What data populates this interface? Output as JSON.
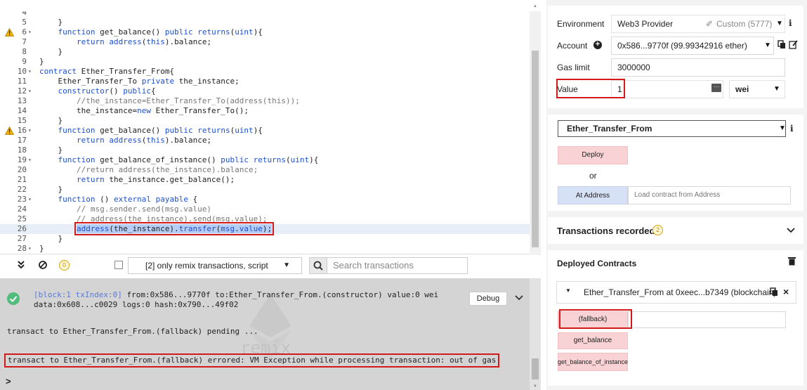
{
  "editor": {
    "lines": [
      {
        "n": "4",
        "fold": false,
        "warn": false,
        "html": "    <span class='kw'></span>"
      },
      {
        "n": "5",
        "fold": false,
        "warn": false,
        "html": "    }"
      },
      {
        "n": "6",
        "fold": true,
        "warn": true,
        "html": "    <span class='kw'>function</span> get_balance() <span class='kw'>public</span> <span class='kw'>returns</span>(<span class='kw'>uint</span>){"
      },
      {
        "n": "7",
        "fold": false,
        "warn": false,
        "html": "        <span class='kw'>return</span> <span class='kw'>address</span>(<span class='kw'>this</span>).balance;"
      },
      {
        "n": "8",
        "fold": false,
        "warn": false,
        "html": "    }"
      },
      {
        "n": "9",
        "fold": false,
        "warn": false,
        "html": "}"
      },
      {
        "n": "10",
        "fold": true,
        "warn": false,
        "html": "<span class='kw'>contract</span> Ether_Transfer_From{"
      },
      {
        "n": "11",
        "fold": false,
        "warn": false,
        "html": "    Ether_Transfer_To <span class='kw'>private</span> the_instance;"
      },
      {
        "n": "12",
        "fold": true,
        "warn": false,
        "html": "    <span class='kw'>constructor</span>() <span class='kw'>public</span>{"
      },
      {
        "n": "13",
        "fold": false,
        "warn": false,
        "html": "        <span class='cm'>//the_instance=Ether_Transfer_To(address(this));</span>"
      },
      {
        "n": "14",
        "fold": false,
        "warn": false,
        "html": "        the_instance=<span class='kw'>new</span> Ether_Transfer_To();"
      },
      {
        "n": "15",
        "fold": false,
        "warn": false,
        "html": "    }"
      },
      {
        "n": "16",
        "fold": true,
        "warn": true,
        "html": "    <span class='kw'>function</span> get_balance() <span class='kw'>public</span> <span class='kw'>returns</span>(<span class='kw'>uint</span>){"
      },
      {
        "n": "17",
        "fold": false,
        "warn": false,
        "html": "        <span class='kw'>return</span> <span class='kw'>address</span>(<span class='kw'>this</span>).balance;"
      },
      {
        "n": "18",
        "fold": false,
        "warn": false,
        "html": "    }"
      },
      {
        "n": "19",
        "fold": true,
        "warn": false,
        "html": "    <span class='kw'>function</span> get_balance_of_instance() <span class='kw'>public</span> <span class='kw'>returns</span>(<span class='kw'>uint</span>){"
      },
      {
        "n": "20",
        "fold": false,
        "warn": false,
        "html": "        <span class='cm'>//return address(the_instance).balance;</span>"
      },
      {
        "n": "21",
        "fold": false,
        "warn": false,
        "html": "        <span class='kw'>return</span> the_instance.get_balance();"
      },
      {
        "n": "22",
        "fold": false,
        "warn": false,
        "html": "    }"
      },
      {
        "n": "23",
        "fold": true,
        "warn": false,
        "html": "    <span class='kw'>function</span> () <span class='kw'>external</span> <span class='kw'>payable</span> {"
      },
      {
        "n": "24",
        "fold": false,
        "warn": false,
        "html": "        <span class='cm'>// msg.sender.send(msg.value)</span>"
      },
      {
        "n": "25",
        "fold": false,
        "warn": false,
        "html": "        <span class='cm'>// address(the_instance).send(msg.value);</span>"
      },
      {
        "n": "26",
        "fold": false,
        "warn": false,
        "active": true,
        "html": "        <span class='hl'><span class='kw'>address</span>(the_instance).<span class='kw'>transfer</span>(<span class='kw'>msg</span>.<span class='kw'>value</span>);</span>"
      },
      {
        "n": "27",
        "fold": false,
        "warn": false,
        "html": "    }"
      },
      {
        "n": "28",
        "fold": true,
        "warn": false,
        "html": "}"
      }
    ]
  },
  "terminal_bar": {
    "badge": "0",
    "filter_label": "[2] only remix transactions, script",
    "search_placeholder": "Search transactions"
  },
  "terminal": {
    "tx_line1_block": "[block:1 txIndex:0]",
    "tx_line1_rest": " from:0x586...9770f to:Ether_Transfer_From.(constructor) value:0 wei",
    "tx_line2": "data:0x608...c0029 logs:0 hash:0x790...49f02",
    "debug_label": "Debug",
    "pending": "transact to Ether_Transfer_From.(fallback) pending ...",
    "errored": "transact to Ether_Transfer_From.(fallback) errored: VM Exception while processing transaction: out of gas",
    "prompt": ">",
    "watermark": "remix"
  },
  "run": {
    "environment_label": "Environment",
    "environment_value": "Web3 Provider",
    "environment_custom": "Custom (5777)",
    "account_label": "Account",
    "account_value": "0x586...9770f (99.99342916 ether)",
    "gas_limit_label": "Gas limit",
    "gas_limit_value": "3000000",
    "value_label": "Value",
    "value_value": "1",
    "value_unit": "wei",
    "contract_value": "Ether_Transfer_From",
    "deploy_label": "Deploy",
    "or_label": "or",
    "at_address_label": "At Address",
    "at_address_placeholder": "Load contract from Address",
    "transactions_recorded_label": "Transactions recorded:",
    "transactions_recorded_count": "2",
    "deployed_contracts_label": "Deployed Contracts",
    "instance_label": "Ether_Transfer_From at 0xeec...b7349 (blockchain)",
    "fallback_label": "(fallback)",
    "get_balance_label": "get_balance",
    "get_balance_of_instance_label": "get_balance_of_instance"
  },
  "colors": {
    "keyword": "#1a4fd6",
    "comment": "#777777",
    "highlight_box": "#d21a1a",
    "pink_button": "#f8d2d4",
    "blue_button": "#d7e1f5",
    "badge": "#c08e00"
  }
}
